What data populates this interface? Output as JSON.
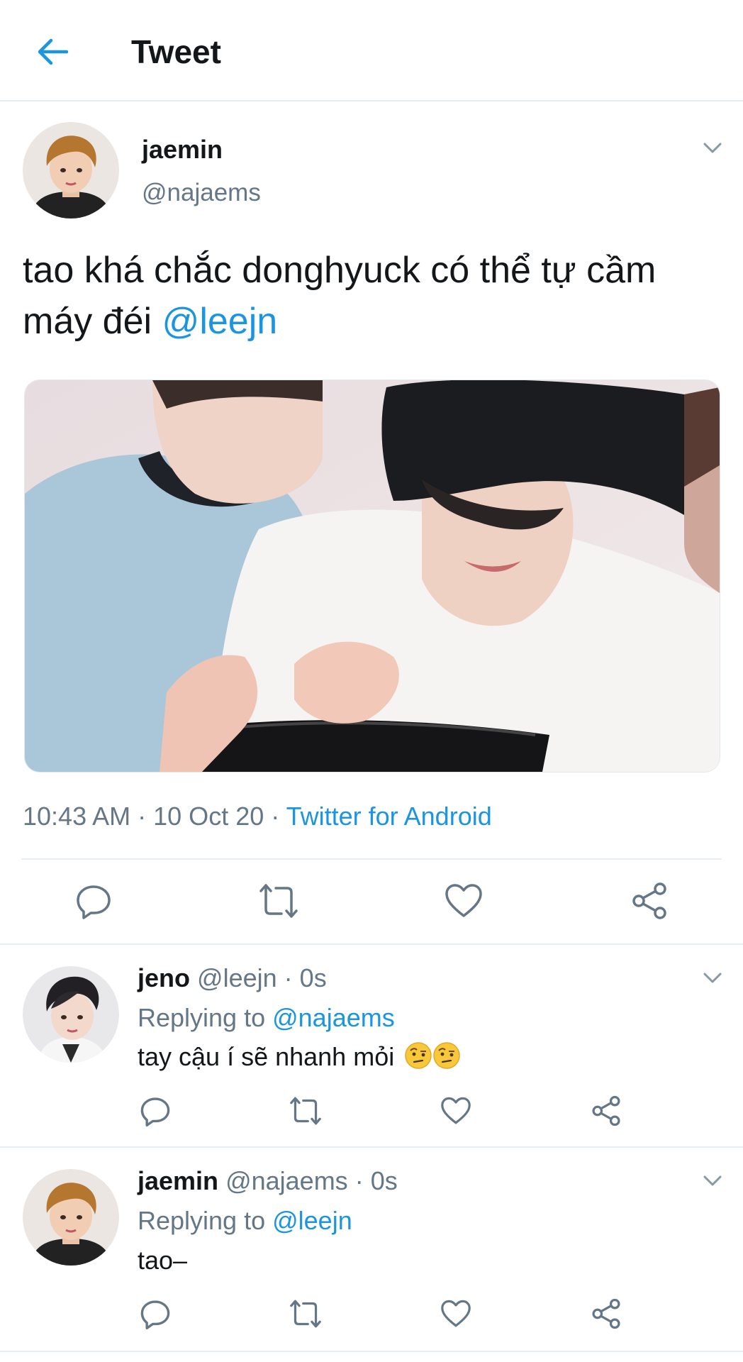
{
  "header": {
    "title": "Tweet"
  },
  "tweet": {
    "name": "jaemin",
    "handle": "@najaems",
    "text": "tao khá chắc donghyuck có thể tự cầm máy đéi ",
    "mention": "@leejn",
    "time": "10:43 AM",
    "date": "10 Oct 20",
    "source": "Twitter for Android",
    "sep": "·"
  },
  "replies": [
    {
      "name": "jeno",
      "handle": "@leejn",
      "age": "0s",
      "replying_prefix": "Replying to ",
      "replying_to": "@najaems",
      "text": "tay cậu í sẽ nhanh mỏi"
    },
    {
      "name": "jaemin",
      "handle": "@najaems",
      "age": "0s",
      "replying_prefix": "Replying to ",
      "replying_to": "@leejn",
      "text": "tao–"
    }
  ],
  "icons": [
    "back-arrow-icon",
    "chevron-down-icon",
    "reply-icon",
    "retweet-icon",
    "like-icon",
    "share-icon",
    "face-with-raised-eyebrow-emoji"
  ],
  "colors": {
    "accent": "#1b95e0",
    "secondary": "#657786",
    "divider": "#e6ecf0"
  }
}
